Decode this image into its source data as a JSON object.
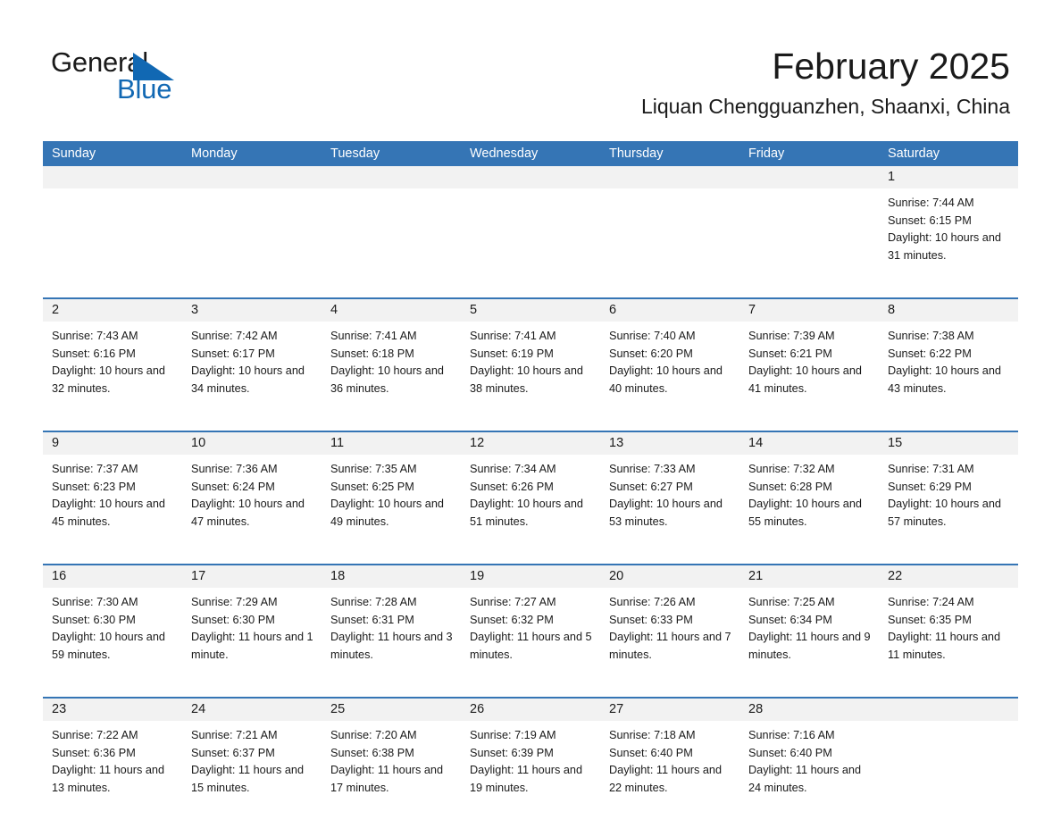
{
  "brand": {
    "name_part1": "General",
    "name_part2": "Blue",
    "accent_color": "#1168b3",
    "logo_icon": "triangle-logo-icon"
  },
  "header": {
    "title": "February 2025",
    "subtitle": "Liquan Chengguanzhen, Shaanxi, China"
  },
  "colors": {
    "header_bar": "#3575b5",
    "day_band": "#f2f2f2",
    "text": "#1a1a1a",
    "header_text": "#ffffff"
  },
  "weekdays": [
    "Sunday",
    "Monday",
    "Tuesday",
    "Wednesday",
    "Thursday",
    "Friday",
    "Saturday"
  ],
  "weeks": [
    [
      {
        "day": "",
        "sunrise": "",
        "sunset": "",
        "daylight": ""
      },
      {
        "day": "",
        "sunrise": "",
        "sunset": "",
        "daylight": ""
      },
      {
        "day": "",
        "sunrise": "",
        "sunset": "",
        "daylight": ""
      },
      {
        "day": "",
        "sunrise": "",
        "sunset": "",
        "daylight": ""
      },
      {
        "day": "",
        "sunrise": "",
        "sunset": "",
        "daylight": ""
      },
      {
        "day": "",
        "sunrise": "",
        "sunset": "",
        "daylight": ""
      },
      {
        "day": "1",
        "sunrise": "Sunrise: 7:44 AM",
        "sunset": "Sunset: 6:15 PM",
        "daylight": "Daylight: 10 hours and 31 minutes."
      }
    ],
    [
      {
        "day": "2",
        "sunrise": "Sunrise: 7:43 AM",
        "sunset": "Sunset: 6:16 PM",
        "daylight": "Daylight: 10 hours and 32 minutes."
      },
      {
        "day": "3",
        "sunrise": "Sunrise: 7:42 AM",
        "sunset": "Sunset: 6:17 PM",
        "daylight": "Daylight: 10 hours and 34 minutes."
      },
      {
        "day": "4",
        "sunrise": "Sunrise: 7:41 AM",
        "sunset": "Sunset: 6:18 PM",
        "daylight": "Daylight: 10 hours and 36 minutes."
      },
      {
        "day": "5",
        "sunrise": "Sunrise: 7:41 AM",
        "sunset": "Sunset: 6:19 PM",
        "daylight": "Daylight: 10 hours and 38 minutes."
      },
      {
        "day": "6",
        "sunrise": "Sunrise: 7:40 AM",
        "sunset": "Sunset: 6:20 PM",
        "daylight": "Daylight: 10 hours and 40 minutes."
      },
      {
        "day": "7",
        "sunrise": "Sunrise: 7:39 AM",
        "sunset": "Sunset: 6:21 PM",
        "daylight": "Daylight: 10 hours and 41 minutes."
      },
      {
        "day": "8",
        "sunrise": "Sunrise: 7:38 AM",
        "sunset": "Sunset: 6:22 PM",
        "daylight": "Daylight: 10 hours and 43 minutes."
      }
    ],
    [
      {
        "day": "9",
        "sunrise": "Sunrise: 7:37 AM",
        "sunset": "Sunset: 6:23 PM",
        "daylight": "Daylight: 10 hours and 45 minutes."
      },
      {
        "day": "10",
        "sunrise": "Sunrise: 7:36 AM",
        "sunset": "Sunset: 6:24 PM",
        "daylight": "Daylight: 10 hours and 47 minutes."
      },
      {
        "day": "11",
        "sunrise": "Sunrise: 7:35 AM",
        "sunset": "Sunset: 6:25 PM",
        "daylight": "Daylight: 10 hours and 49 minutes."
      },
      {
        "day": "12",
        "sunrise": "Sunrise: 7:34 AM",
        "sunset": "Sunset: 6:26 PM",
        "daylight": "Daylight: 10 hours and 51 minutes."
      },
      {
        "day": "13",
        "sunrise": "Sunrise: 7:33 AM",
        "sunset": "Sunset: 6:27 PM",
        "daylight": "Daylight: 10 hours and 53 minutes."
      },
      {
        "day": "14",
        "sunrise": "Sunrise: 7:32 AM",
        "sunset": "Sunset: 6:28 PM",
        "daylight": "Daylight: 10 hours and 55 minutes."
      },
      {
        "day": "15",
        "sunrise": "Sunrise: 7:31 AM",
        "sunset": "Sunset: 6:29 PM",
        "daylight": "Daylight: 10 hours and 57 minutes."
      }
    ],
    [
      {
        "day": "16",
        "sunrise": "Sunrise: 7:30 AM",
        "sunset": "Sunset: 6:30 PM",
        "daylight": "Daylight: 10 hours and 59 minutes."
      },
      {
        "day": "17",
        "sunrise": "Sunrise: 7:29 AM",
        "sunset": "Sunset: 6:30 PM",
        "daylight": "Daylight: 11 hours and 1 minute."
      },
      {
        "day": "18",
        "sunrise": "Sunrise: 7:28 AM",
        "sunset": "Sunset: 6:31 PM",
        "daylight": "Daylight: 11 hours and 3 minutes."
      },
      {
        "day": "19",
        "sunrise": "Sunrise: 7:27 AM",
        "sunset": "Sunset: 6:32 PM",
        "daylight": "Daylight: 11 hours and 5 minutes."
      },
      {
        "day": "20",
        "sunrise": "Sunrise: 7:26 AM",
        "sunset": "Sunset: 6:33 PM",
        "daylight": "Daylight: 11 hours and 7 minutes."
      },
      {
        "day": "21",
        "sunrise": "Sunrise: 7:25 AM",
        "sunset": "Sunset: 6:34 PM",
        "daylight": "Daylight: 11 hours and 9 minutes."
      },
      {
        "day": "22",
        "sunrise": "Sunrise: 7:24 AM",
        "sunset": "Sunset: 6:35 PM",
        "daylight": "Daylight: 11 hours and 11 minutes."
      }
    ],
    [
      {
        "day": "23",
        "sunrise": "Sunrise: 7:22 AM",
        "sunset": "Sunset: 6:36 PM",
        "daylight": "Daylight: 11 hours and 13 minutes."
      },
      {
        "day": "24",
        "sunrise": "Sunrise: 7:21 AM",
        "sunset": "Sunset: 6:37 PM",
        "daylight": "Daylight: 11 hours and 15 minutes."
      },
      {
        "day": "25",
        "sunrise": "Sunrise: 7:20 AM",
        "sunset": "Sunset: 6:38 PM",
        "daylight": "Daylight: 11 hours and 17 minutes."
      },
      {
        "day": "26",
        "sunrise": "Sunrise: 7:19 AM",
        "sunset": "Sunset: 6:39 PM",
        "daylight": "Daylight: 11 hours and 19 minutes."
      },
      {
        "day": "27",
        "sunrise": "Sunrise: 7:18 AM",
        "sunset": "Sunset: 6:40 PM",
        "daylight": "Daylight: 11 hours and 22 minutes."
      },
      {
        "day": "28",
        "sunrise": "Sunrise: 7:16 AM",
        "sunset": "Sunset: 6:40 PM",
        "daylight": "Daylight: 11 hours and 24 minutes."
      },
      {
        "day": "",
        "sunrise": "",
        "sunset": "",
        "daylight": ""
      }
    ]
  ]
}
